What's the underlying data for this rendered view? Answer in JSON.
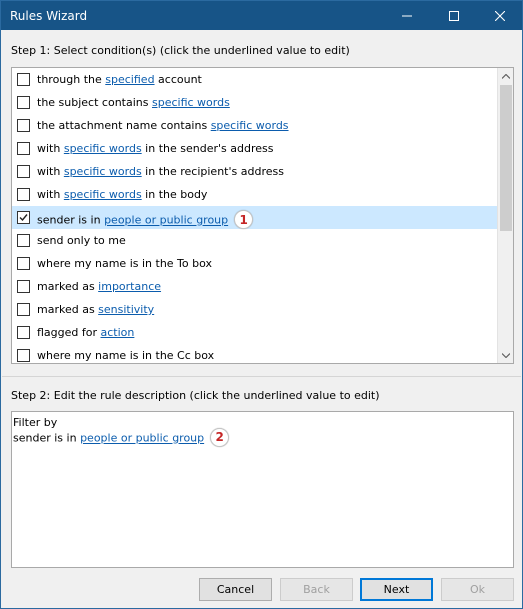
{
  "window": {
    "title": "Rules Wizard"
  },
  "step1": {
    "label": "Step 1: Select condition(s) (click the underlined value to edit)"
  },
  "conditions": [
    {
      "pre": "through the ",
      "link": "specified",
      "post": " account",
      "checked": false
    },
    {
      "pre": "the subject contains ",
      "link": "specific words",
      "post": "",
      "checked": false
    },
    {
      "pre": "the attachment name contains ",
      "link": "specific words",
      "post": "",
      "checked": false
    },
    {
      "pre": "with ",
      "link": "specific words",
      "post": " in the sender's address",
      "checked": false
    },
    {
      "pre": "with ",
      "link": "specific words",
      "post": " in the recipient's address",
      "checked": false
    },
    {
      "pre": "with ",
      "link": "specific words",
      "post": " in the body",
      "checked": false
    },
    {
      "pre": "sender is in ",
      "link": "people or public group",
      "post": "",
      "checked": true,
      "badge": "1"
    },
    {
      "pre": "send only to me",
      "link": "",
      "post": "",
      "checked": false
    },
    {
      "pre": "where my name is in the To box",
      "link": "",
      "post": "",
      "checked": false
    },
    {
      "pre": "marked as ",
      "link": "importance",
      "post": "",
      "checked": false
    },
    {
      "pre": "marked as ",
      "link": "sensitivity",
      "post": "",
      "checked": false
    },
    {
      "pre": "flagged for ",
      "link": "action",
      "post": "",
      "checked": false
    },
    {
      "pre": "where my name is in the Cc box",
      "link": "",
      "post": "",
      "checked": false
    }
  ],
  "step2": {
    "label": "Step 2: Edit the rule description (click the underlined value to edit)",
    "line1": "Filter by",
    "line2_pre": "sender is in ",
    "line2_link": "people or public group",
    "badge": "2"
  },
  "buttons": {
    "cancel": "Cancel",
    "back": "Back",
    "next": "Next",
    "ok": "Ok"
  },
  "colors": {
    "titlebar": "#175487",
    "link": "#0b5cad",
    "selection": "#cce8ff",
    "badge_text": "#c52626"
  }
}
